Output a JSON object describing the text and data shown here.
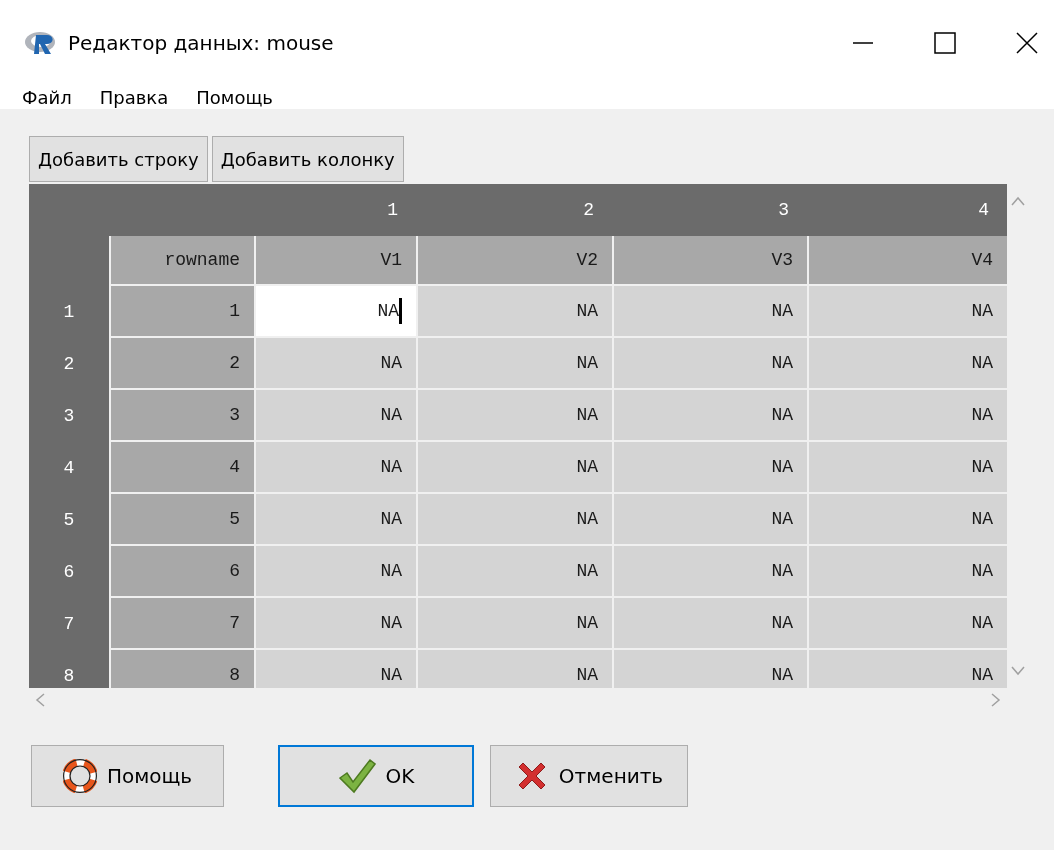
{
  "window": {
    "title": "Редактор данных: mouse"
  },
  "menu": [
    "Файл",
    "Правка",
    "Помощь"
  ],
  "toolbar": [
    "Добавить строку",
    "Добавить колонку"
  ],
  "grid": {
    "column_numbers": [
      "1",
      "2",
      "3",
      "4"
    ],
    "column_names": [
      "rowname",
      "V1",
      "V2",
      "V3",
      "V4"
    ],
    "rows": [
      {
        "number": "1",
        "rowname": "1",
        "cells": [
          {
            "value": "NA",
            "selected": true
          },
          {
            "value": "NA",
            "selected": false
          },
          {
            "value": "NA",
            "selected": false
          },
          {
            "value": "NA",
            "selected": false
          }
        ]
      },
      {
        "number": "2",
        "rowname": "2",
        "cells": [
          {
            "value": "NA",
            "selected": false
          },
          {
            "value": "NA",
            "selected": false
          },
          {
            "value": "NA",
            "selected": false
          },
          {
            "value": "NA",
            "selected": false
          }
        ]
      },
      {
        "number": "3",
        "rowname": "3",
        "cells": [
          {
            "value": "NA",
            "selected": false
          },
          {
            "value": "NA",
            "selected": false
          },
          {
            "value": "NA",
            "selected": false
          },
          {
            "value": "NA",
            "selected": false
          }
        ]
      },
      {
        "number": "4",
        "rowname": "4",
        "cells": [
          {
            "value": "NA",
            "selected": false
          },
          {
            "value": "NA",
            "selected": false
          },
          {
            "value": "NA",
            "selected": false
          },
          {
            "value": "NA",
            "selected": false
          }
        ]
      },
      {
        "number": "5",
        "rowname": "5",
        "cells": [
          {
            "value": "NA",
            "selected": false
          },
          {
            "value": "NA",
            "selected": false
          },
          {
            "value": "NA",
            "selected": false
          },
          {
            "value": "NA",
            "selected": false
          }
        ]
      },
      {
        "number": "6",
        "rowname": "6",
        "cells": [
          {
            "value": "NA",
            "selected": false
          },
          {
            "value": "NA",
            "selected": false
          },
          {
            "value": "NA",
            "selected": false
          },
          {
            "value": "NA",
            "selected": false
          }
        ]
      },
      {
        "number": "7",
        "rowname": "7",
        "cells": [
          {
            "value": "NA",
            "selected": false
          },
          {
            "value": "NA",
            "selected": false
          },
          {
            "value": "NA",
            "selected": false
          },
          {
            "value": "NA",
            "selected": false
          }
        ]
      },
      {
        "number": "8",
        "rowname": "8",
        "cells": [
          {
            "value": "NA",
            "selected": false
          },
          {
            "value": "NA",
            "selected": false
          },
          {
            "value": "NA",
            "selected": false
          },
          {
            "value": "NA",
            "selected": false
          }
        ]
      }
    ]
  },
  "buttons": [
    {
      "label": "Помощь",
      "kind": "help",
      "focused": false
    },
    {
      "label": "OK",
      "kind": "ok",
      "focused": true
    },
    {
      "label": "Отменить",
      "kind": "cancel",
      "focused": false
    }
  ]
}
